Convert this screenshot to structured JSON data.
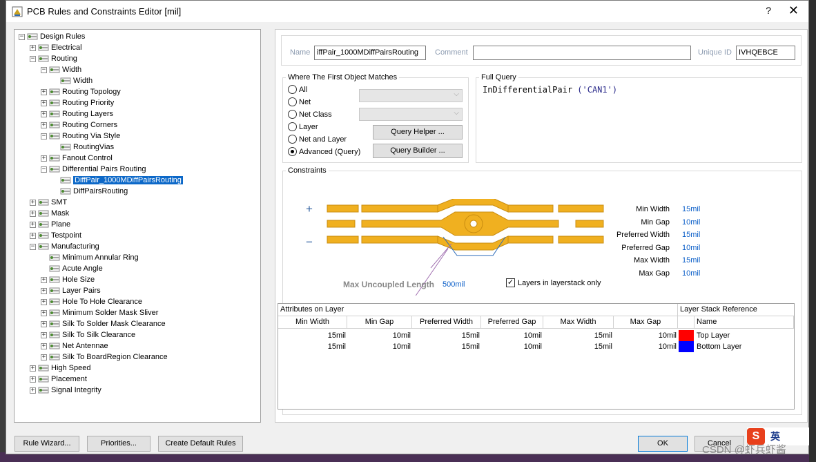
{
  "window": {
    "title": "PCB Rules and Constraints Editor [mil]",
    "help_label": "?",
    "close_label": "✕"
  },
  "tree": [
    {
      "label": "Design Rules",
      "expander": "−"
    },
    {
      "label": "Electrical",
      "expander": "+"
    },
    {
      "label": "Routing",
      "expander": "−"
    },
    {
      "label": "Width",
      "expander": "−"
    },
    {
      "label": "Width",
      "expander": ""
    },
    {
      "label": "Routing Topology",
      "expander": "+"
    },
    {
      "label": "Routing Priority",
      "expander": "+"
    },
    {
      "label": "Routing Layers",
      "expander": "+"
    },
    {
      "label": "Routing Corners",
      "expander": "+"
    },
    {
      "label": "Routing Via Style",
      "expander": "−"
    },
    {
      "label": "RoutingVias",
      "expander": ""
    },
    {
      "label": "Fanout Control",
      "expander": "+"
    },
    {
      "label": "Differential Pairs Routing",
      "expander": "−"
    },
    {
      "label": "DiffPair_1000MDiffPairsRouting",
      "expander": ""
    },
    {
      "label": "DiffPairsRouting",
      "expander": ""
    },
    {
      "label": "SMT",
      "expander": "+"
    },
    {
      "label": "Mask",
      "expander": "+"
    },
    {
      "label": "Plane",
      "expander": "+"
    },
    {
      "label": "Testpoint",
      "expander": "+"
    },
    {
      "label": "Manufacturing",
      "expander": "−"
    },
    {
      "label": "Minimum Annular Ring",
      "expander": ""
    },
    {
      "label": "Acute Angle",
      "expander": ""
    },
    {
      "label": "Hole Size",
      "expander": "+"
    },
    {
      "label": "Layer Pairs",
      "expander": "+"
    },
    {
      "label": "Hole To Hole Clearance",
      "expander": "+"
    },
    {
      "label": "Minimum Solder Mask Sliver",
      "expander": "+"
    },
    {
      "label": "Silk To Solder Mask Clearance",
      "expander": "+"
    },
    {
      "label": "Silk To Silk Clearance",
      "expander": "+"
    },
    {
      "label": "Net Antennae",
      "expander": "+"
    },
    {
      "label": "Silk To BoardRegion Clearance",
      "expander": "+"
    },
    {
      "label": "High Speed",
      "expander": "+"
    },
    {
      "label": "Placement",
      "expander": "+"
    },
    {
      "label": "Signal Integrity",
      "expander": "+"
    }
  ],
  "rule": {
    "name_label": "Name",
    "name_value": "iffPair_1000MDiffPairsRouting",
    "comment_label": "Comment",
    "comment_value": "",
    "uid_label": "Unique ID",
    "uid_value": "IVHQEBCE"
  },
  "match": {
    "title": "Where The First Object Matches",
    "options": [
      "All",
      "Net",
      "Net Class",
      "Layer",
      "Net and Layer",
      "Advanced (Query)"
    ],
    "selected": "Advanced (Query)",
    "query_helper": "Query Helper ...",
    "query_builder": "Query Builder ..."
  },
  "full_query": {
    "title": "Full Query",
    "fn": "InDifferentialPair ",
    "arg": "('CAN1')"
  },
  "constraints": {
    "title": "Constraints",
    "plus": "+",
    "minus": "−",
    "max_uncoupled_label": "Max Uncoupled Length",
    "max_uncoupled_value": "500mil",
    "layerstack_only_label": "Layers in layerstack only",
    "layerstack_only_checked": true,
    "rows": [
      {
        "label": "Min Width",
        "value": "15mil"
      },
      {
        "label": "Min Gap",
        "value": "10mil"
      },
      {
        "label": "Preferred Width",
        "value": "15mil"
      },
      {
        "label": "Preferred Gap",
        "value": "10mil"
      },
      {
        "label": "Max Width",
        "value": "15mil"
      },
      {
        "label": "Max Gap",
        "value": "10mil"
      }
    ]
  },
  "table": {
    "attr_header": "Attributes on Layer",
    "stack_header": "Layer Stack Reference",
    "columns": [
      "Min Width",
      "Min Gap",
      "Preferred Width",
      "Preferred Gap",
      "Max Width",
      "Max Gap"
    ],
    "name_col": "Name",
    "rows": [
      {
        "values": [
          "15mil",
          "10mil",
          "15mil",
          "10mil",
          "15mil",
          "10mil"
        ],
        "color": "#ff0000",
        "name": "Top Layer"
      },
      {
        "values": [
          "15mil",
          "10mil",
          "15mil",
          "10mil",
          "15mil",
          "10mil"
        ],
        "color": "#0000ff",
        "name": "Bottom Layer"
      }
    ]
  },
  "buttons": {
    "rule_wizard": "Rule Wizard...",
    "priorities": "Priorities...",
    "create_default": "Create Default Rules",
    "ok": "OK",
    "cancel": "Cancel"
  },
  "overlay": {
    "watermark": "CSDN @虾兵虾酱",
    "ime_text": "英"
  },
  "colors": {
    "trace": "#f0b020",
    "selection": "#0c68c8",
    "value_blue": "#0a5ec8"
  }
}
